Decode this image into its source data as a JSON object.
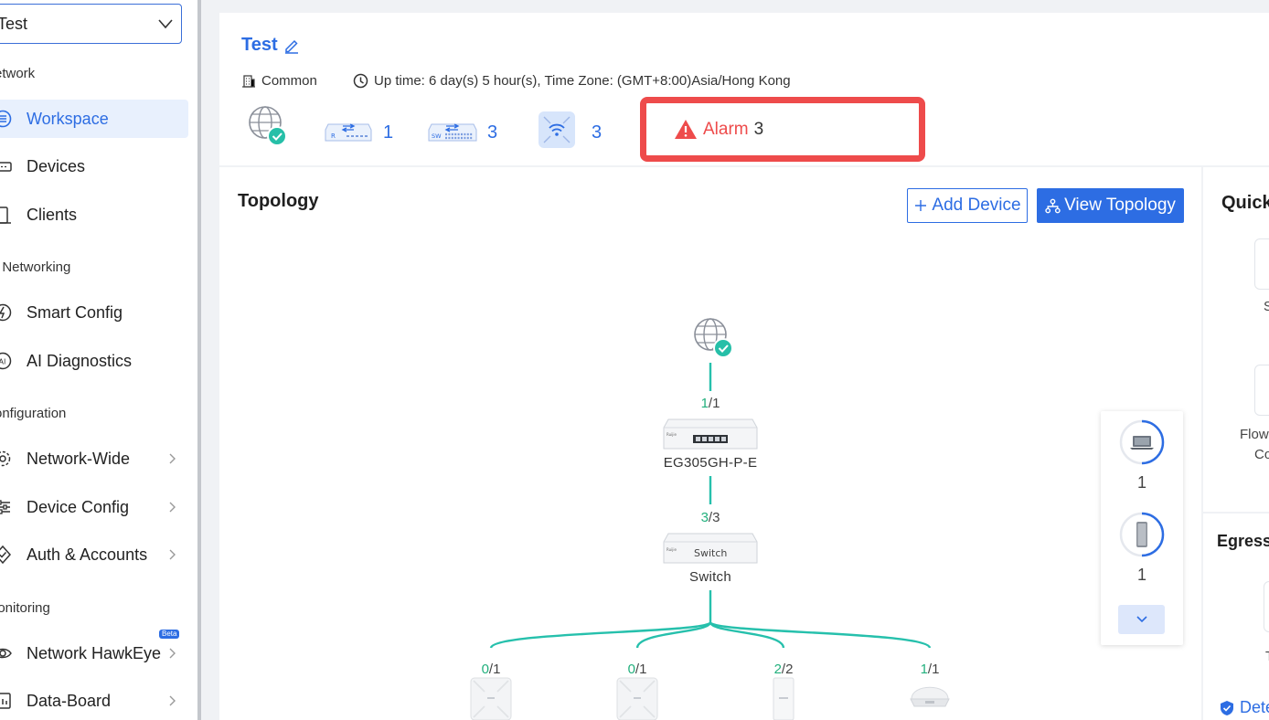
{
  "sidebar": {
    "site_select": "Test",
    "sections": {
      "network": "etwork",
      "ai_networking": "I Networking",
      "configuration": "onfiguration",
      "monitoring": "lonitoring"
    },
    "items": {
      "workspace": "Workspace",
      "devices": "Devices",
      "clients": "Clients",
      "smart_config": "Smart Config",
      "ai_diagnostics": "AI Diagnostics",
      "network_wide": "Network-Wide",
      "device_config": "Device Config",
      "auth_accounts": "Auth & Accounts",
      "network_hawkeye": "Network HawkEye",
      "data_board": "Data-Board"
    },
    "beta_badge": "Beta"
  },
  "header": {
    "site_name": "Test",
    "group": "Common",
    "uptime": "Up time: 6 day(s) 5 hour(s), Time Zone: (GMT+8:00)Asia/Hong Kong",
    "router_count": "1",
    "switch_count": "3",
    "ap_count": "3",
    "alarm_label": "Alarm",
    "alarm_count": "3"
  },
  "topology": {
    "title": "Topology",
    "add_device": "Add Device",
    "view_topology": "View Topology",
    "gateway": {
      "port_up": "1",
      "port_total": "/1",
      "name": "EG305GH-P-E",
      "face_label": "Ruijie"
    },
    "switch": {
      "port_up": "3",
      "port_total": "/3",
      "name": "Switch",
      "face_label": "Switch",
      "brand": "Ruijie"
    },
    "aps": [
      {
        "port_up": "0",
        "port_total": "/1"
      },
      {
        "port_up": "0",
        "port_total": "/1"
      },
      {
        "port_up": "2",
        "port_total": "/2"
      },
      {
        "port_up": "1",
        "port_total": "/1"
      }
    ]
  },
  "clients": {
    "laptop_count": "1",
    "phone_count": "1"
  },
  "right_panel": {
    "quick_title": "Quick",
    "text_s": "S",
    "flow_line1": "Flow",
    "flow_line2": "Co",
    "egress_title": "Egress",
    "text_t": "T",
    "detect": "Dete"
  },
  "colors": {
    "primary": "#2d6de3",
    "alarm": "#ee4b4b",
    "online": "#22b07d",
    "link": "#26c0ac"
  }
}
